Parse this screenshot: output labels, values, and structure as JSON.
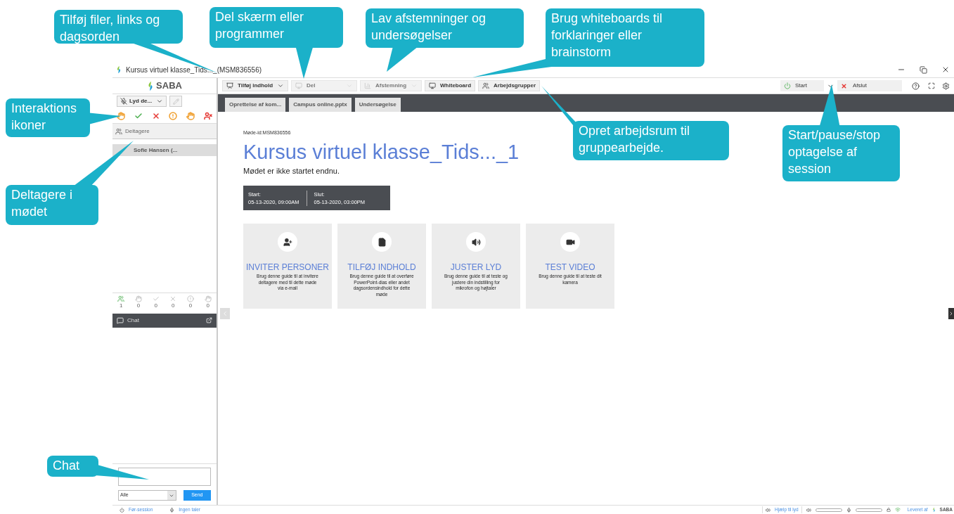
{
  "title_bar": {
    "title": "Kursus virtuel klasse_Tids..._(MSM836556)"
  },
  "left_panel": {
    "logo": "SABA",
    "audio_button": "Lyd de...",
    "participants_header": "Deltagere",
    "participants": [
      {
        "name": "Sofie Hansen (...",
        "selected": true
      }
    ],
    "status_counts": [
      {
        "count": "1",
        "highlighted": true
      },
      {
        "count": "0",
        "highlighted": false
      },
      {
        "count": "0",
        "highlighted": false
      },
      {
        "count": "0",
        "highlighted": false
      },
      {
        "count": "0",
        "highlighted": false
      },
      {
        "count": "0",
        "highlighted": false
      }
    ],
    "chat_header": "Chat",
    "chat_recipient": "Alle",
    "send_button": "Send"
  },
  "toolbar": [
    {
      "label": "Tilføj indhold",
      "kind": "content",
      "disabled": false
    },
    {
      "label": "Del",
      "kind": "share",
      "disabled": true
    },
    {
      "label": "Afstemning",
      "kind": "poll",
      "disabled": true
    },
    {
      "label": "Whiteboard",
      "kind": "whiteboard",
      "disabled": false
    },
    {
      "label": "Arbejdsgrupper",
      "kind": "groups",
      "disabled": false
    }
  ],
  "recording": {
    "start": "Start",
    "stop": "Afslut"
  },
  "tabs": [
    {
      "label": "Oprettelse af kom...",
      "selected": false
    },
    {
      "label": "Campus online.pptx",
      "selected": false
    },
    {
      "label": "Undersøgelse",
      "selected": false
    }
  ],
  "content": {
    "meeting_id": "Møde-id:MSM836556",
    "title": "Kursus virtuel klasse_Tids..._1",
    "status": "Mødet er ikke startet endnu.",
    "schedule": [
      {
        "label": "Start:",
        "value": "05-13-2020, 09:00AM"
      },
      {
        "label": "Slut:",
        "value": "05-13-2020, 03:00PM"
      }
    ],
    "cards": [
      {
        "kind": "invite",
        "title": "INVITER PERSONER",
        "text": "Brug denne guide til at invitere deltagere med til dette møde via e-mail"
      },
      {
        "kind": "content",
        "title": "TILFØJ INDHOLD",
        "text": "Brug denne guide til at overføre PowerPoint-dias eller andet dagsordensindhold for dette møde"
      },
      {
        "kind": "audio",
        "title": "JUSTER LYD",
        "text": "Brug denne guide til at teste og justere din indstilling for mikrofon og højtaler"
      },
      {
        "kind": "video",
        "title": "TEST VIDEO",
        "text": "Brug denne guide til at teste dit kamera"
      }
    ]
  },
  "footer": {
    "session": "Før-session",
    "speaker": "Ingen taler",
    "audio_help": "Hjælp til lyd",
    "powered_by": "Leveret af",
    "brand": "SABA"
  },
  "callouts": [
    {
      "text": "Tilføj filer, links og dagsorden"
    },
    {
      "text": "Del skærm eller programmer"
    },
    {
      "text": "Lav afstemninger og undersøgelser"
    },
    {
      "text": "Brug whiteboards til forklaringer eller brainstorm"
    },
    {
      "text": "Interaktions ikoner"
    },
    {
      "text": "Deltagere i mødet"
    },
    {
      "text": "Opret arbejdsrum til gruppearbejde."
    },
    {
      "text": "Start/pause/stop optagelse af session"
    },
    {
      "text": "Chat"
    }
  ]
}
